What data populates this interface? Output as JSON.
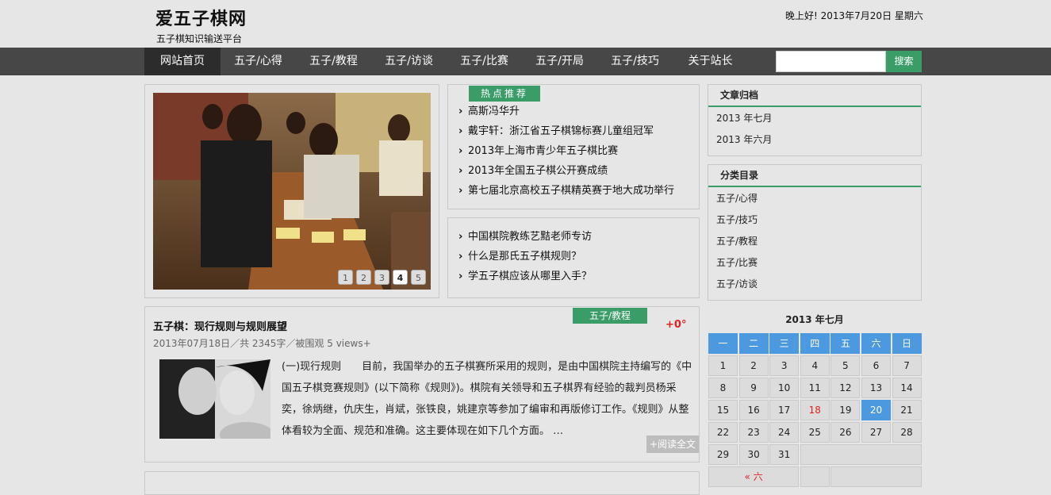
{
  "header": {
    "site_title": "爱五子棋网",
    "site_subtitle": "五子棋知识输送平台",
    "greeting": "晚上好! 2013年7月20日 星期六"
  },
  "nav": {
    "items": [
      {
        "label": "网站首页",
        "active": true
      },
      {
        "label": "五子/心得"
      },
      {
        "label": "五子/教程"
      },
      {
        "label": "五子/访谈"
      },
      {
        "label": "五子/比赛"
      },
      {
        "label": "五子/开局"
      },
      {
        "label": "五子/技巧"
      },
      {
        "label": "关于站长"
      }
    ],
    "search_placeholder": "",
    "search_button": "搜索"
  },
  "slider": {
    "pages": [
      "1",
      "2",
      "3",
      "4",
      "5"
    ],
    "current_page": 4,
    "image_desc": "gomoku-tournament-photo"
  },
  "hot": {
    "tag": "热点推荐",
    "items": [
      "高斯冯华升",
      "戴宇轩：浙江省五子棋锦标赛儿童组冠军",
      "2013年上海市青少年五子棋比赛",
      "2013年全国五子棋公开赛成绩",
      "第七届北京高校五子棋精英赛于地大成功举行"
    ]
  },
  "more_links": {
    "items": [
      "中国棋院教练艺黠老师专访",
      "什么是那氏五子棋规则？",
      "学五子棋应该从哪里入手？"
    ]
  },
  "article": {
    "category": "五子/教程",
    "likes": "+0°",
    "title": "五子棋：现行规则与规则展望",
    "meta": "2013年07月18日／共 2345字／被围观 5 views+",
    "body": "(一)现行规则　　目前，我国举办的五子棋赛所采用的规则，是由中国棋院主持编写的《中国五子棋竞赛规则》(以下简称《规则》)。棋院有关领导和五子棋界有经验的裁判员杨采奕，徐炳继，仇庆生，肖斌，张铁良，姚建京等参加了编审和再版修订工作。《规则》从整体看较为全面、规范和准确。这主要体现在如下几个方面。 …",
    "read_more": "+阅读全文"
  },
  "sidebar": {
    "archive_title": "文章归档",
    "archive_items": [
      "2013 年七月",
      "2013 年六月"
    ],
    "category_title": "分类目录",
    "category_items": [
      "五子/心得",
      "五子/技巧",
      "五子/教程",
      "五子/比赛",
      "五子/访谈"
    ]
  },
  "calendar": {
    "caption": "2013 年七月",
    "weekdays": [
      "一",
      "二",
      "三",
      "四",
      "五",
      "六",
      "日"
    ],
    "weeks": [
      [
        "1",
        "2",
        "3",
        "4",
        "5",
        "6",
        "7"
      ],
      [
        "8",
        "9",
        "10",
        "11",
        "12",
        "13",
        "14"
      ],
      [
        "15",
        "16",
        "17",
        "18",
        "19",
        "20",
        "21"
      ],
      [
        "22",
        "23",
        "24",
        "25",
        "26",
        "27",
        "28"
      ],
      [
        "29",
        "30",
        "31",
        "",
        "",
        "",
        ""
      ]
    ],
    "today": "20",
    "highlight_red": "18",
    "prev_link": "« 六"
  },
  "colors": {
    "nav_bg": "#474747",
    "accent_green": "#3a9d68",
    "calendar_blue": "#4d99df",
    "likes_red": "#d22222"
  }
}
